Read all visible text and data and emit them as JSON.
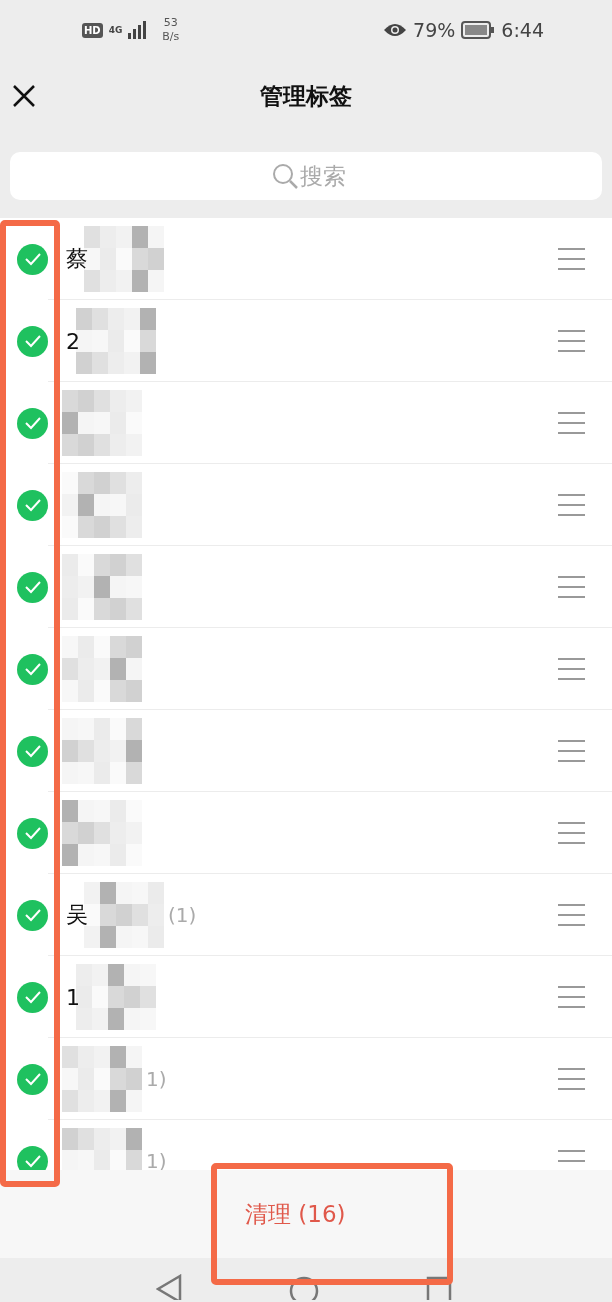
{
  "status_bar": {
    "hd_badge": "HD",
    "network": "4G",
    "speed_value": "53",
    "speed_unit": "B/s",
    "battery": "79%",
    "time": "6:44"
  },
  "header": {
    "title": "管理标签"
  },
  "search": {
    "placeholder": "搜索"
  },
  "tags": [
    {
      "name": "蔡",
      "checked": true
    },
    {
      "name": "2",
      "checked": true
    },
    {
      "checked": true
    },
    {
      "checked": true
    },
    {
      "checked": true
    },
    {
      "checked": true
    },
    {
      "checked": true
    },
    {
      "checked": true
    },
    {
      "name": "吴",
      "count": "(1)",
      "checked": true
    },
    {
      "name": "1",
      "checked": true
    },
    {
      "count": "1)",
      "checked": true
    },
    {
      "count": "1)",
      "checked": true
    }
  ],
  "footer": {
    "button": "清理 (16)"
  }
}
